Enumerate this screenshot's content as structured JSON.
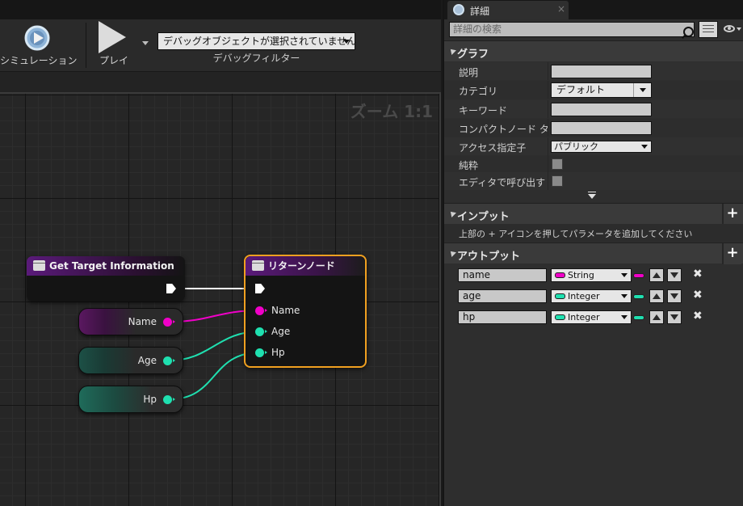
{
  "toolbar": {
    "simulation_label": "シミュレーション",
    "play_label": "プレイ",
    "debug_object_value": "デバッグオブジェクトが選択されていません",
    "debug_filter_label": "デバッグフィルター"
  },
  "graph": {
    "zoom_label": "ズーム 1:1",
    "function_node": {
      "title": "Get Target Information"
    },
    "return_node": {
      "title": "リターンノード",
      "pins": [
        "Name",
        "Age",
        "Hp"
      ]
    },
    "variables": [
      {
        "label": "Name",
        "type": "String"
      },
      {
        "label": "Age",
        "type": "Integer"
      },
      {
        "label": "Hp",
        "type": "Integer"
      }
    ]
  },
  "colors": {
    "string_pin": "#f000c8",
    "integer_pin": "#1fe0b0",
    "exec_pin": "#ffffff",
    "selected_border": "#f0a020",
    "function_title": "#5a1a7a"
  },
  "details": {
    "tab_label": "詳細",
    "tab_icon": "details-icon",
    "close_glyph": "×",
    "search_placeholder": "詳細の検索",
    "graph_section": {
      "title": "グラフ",
      "labels": {
        "description": "説明",
        "category": "カテゴリ",
        "keyword": "キーワード",
        "compact_title": "コンパクトノード タイトル",
        "access": "アクセス指定子",
        "pure": "純粋",
        "call_in_editor": "エディタで呼び出す"
      },
      "category_value": "デフォルト",
      "access_value": "パブリック"
    },
    "input_section": {
      "title": "インプット",
      "hint": "上部の + アイコンを押してパラメータを追加してください",
      "add_glyph": "+"
    },
    "output_section": {
      "title": "アウトプット",
      "add_glyph": "+",
      "remove_glyph": "✖",
      "rows": [
        {
          "name": "name",
          "type": "String"
        },
        {
          "name": "age",
          "type": "Integer"
        },
        {
          "name": "hp",
          "type": "Integer"
        }
      ]
    }
  }
}
